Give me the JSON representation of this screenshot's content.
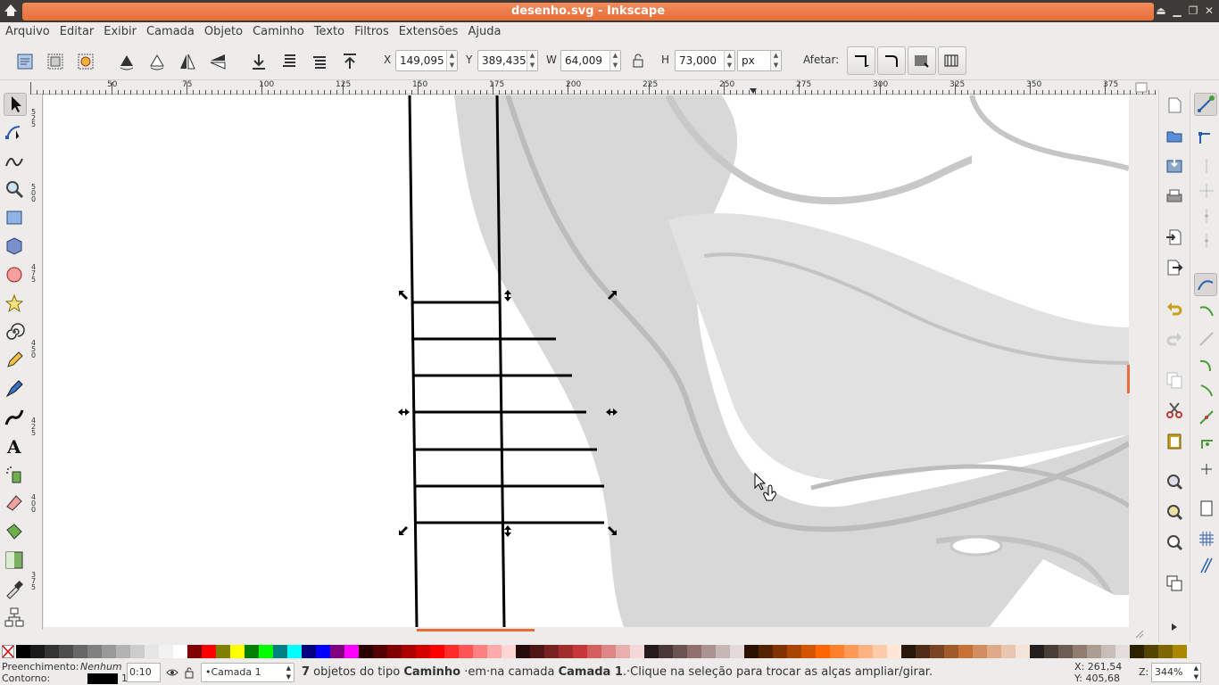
{
  "window": {
    "title": "desenho.svg - Inkscape"
  },
  "menu": [
    "Arquivo",
    "Editar",
    "Exibir",
    "Camada",
    "Objeto",
    "Caminho",
    "Texto",
    "Filtros",
    "Extensões",
    "Ajuda"
  ],
  "toolbar": {
    "x_label": "X",
    "x_value": "149,095",
    "y_label": "Y",
    "y_value": "389,435",
    "w_label": "W",
    "w_value": "64,009",
    "h_label": "H",
    "h_value": "73,000",
    "unit": "px",
    "affect_label": "Afetar:"
  },
  "ruler": {
    "h_ticks": [
      "50",
      "75",
      "100",
      "125",
      "150",
      "175",
      "200",
      "225",
      "250",
      "275",
      "300",
      "325",
      "350",
      "375"
    ],
    "v_ticks": [
      "525",
      "500",
      "475",
      "450",
      "425",
      "400",
      "375"
    ]
  },
  "status": {
    "fill_label": "Preenchimento:",
    "fill_value": "Nenhum",
    "stroke_label": "Contorno:",
    "stroke_width": "1",
    "opacity_value": "0:10",
    "layer": "•Camada 1",
    "message_count": "7",
    "message_p1": " objetos do tipo ",
    "message_type": "Caminho",
    "message_p2": " ·em·na camada ",
    "message_layer": "Camada 1",
    "message_p3": ".·Clique na seleção para trocar as alças ampliar/girar.",
    "cursor_x": "X: 261,54",
    "cursor_y": "Y: 405,68",
    "zoom_label": "Z:",
    "zoom_value": "344%"
  },
  "colors": {
    "title_accent": "#e86d38",
    "selection_black": "#000000",
    "background_sketch": "#d9d9d9"
  }
}
